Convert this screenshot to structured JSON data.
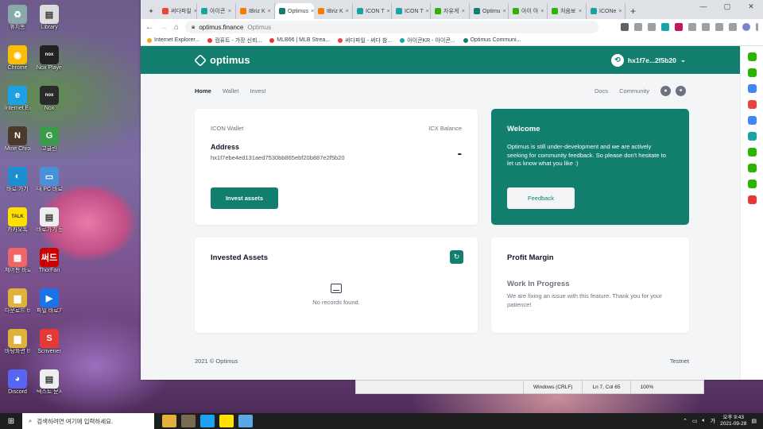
{
  "desktop": {
    "icons": [
      {
        "label": "휴지통",
        "color": "#8aa",
        "glyph": "♻"
      },
      {
        "label": "Library",
        "color": "#ddd",
        "glyph": "▤"
      },
      {
        "label": "Chrome",
        "color": "#fbbc05",
        "glyph": "◉"
      },
      {
        "label": "Nox Player",
        "color": "#222",
        "glyph": "nox"
      },
      {
        "label": "Internet Explorer",
        "color": "#1ea0e4",
        "glyph": "e"
      },
      {
        "label": "Nox",
        "color": "#2a2a2a",
        "glyph": "nox"
      },
      {
        "label": "Mine Chronicles",
        "color": "#4a3a2a",
        "glyph": "N"
      },
      {
        "label": "고클린",
        "color": "#3b9c4b",
        "glyph": "G"
      },
      {
        "label": "바로 가기",
        "color": "#1b8fd0",
        "glyph": "◐"
      },
      {
        "label": "내 PC 바로가기",
        "color": "#4a90d9",
        "glyph": "▭"
      },
      {
        "label": "카카오톡",
        "color": "#ffe000",
        "glyph": "TALK"
      },
      {
        "label": "바로가기 문서",
        "color": "#eee",
        "glyph": "▤"
      },
      {
        "label": "제어판 바로가기",
        "color": "#e66",
        "glyph": "▦"
      },
      {
        "label": "ThorFan",
        "color": "#c00",
        "glyph": "써드"
      },
      {
        "label": "다운로드 바로가기",
        "color": "#e0b23c",
        "glyph": "▆"
      },
      {
        "label": "파일 바로가기",
        "color": "#1a73e8",
        "glyph": "▶"
      },
      {
        "label": "바탕화면 바로가기",
        "color": "#e0b23c",
        "glyph": "▆"
      },
      {
        "label": "Scrivener",
        "color": "#e53935",
        "glyph": "S"
      },
      {
        "label": "Discord",
        "color": "#5865f2",
        "glyph": "◕"
      },
      {
        "label": "텍스트 문서",
        "color": "#eee",
        "glyph": "▤"
      }
    ]
  },
  "browser": {
    "tabs": [
      {
        "label": "써다파일",
        "color": "#e8453c",
        "active": false
      },
      {
        "label": "아이콘",
        "color": "#1aa3a3",
        "active": false
      },
      {
        "label": "IBriz K",
        "color": "#f57c00",
        "active": false
      },
      {
        "label": "Optimus",
        "color": "#127e6d",
        "active": true
      },
      {
        "label": "IBriz K",
        "color": "#f57c00",
        "active": false
      },
      {
        "label": "ICON T",
        "color": "#1aa3a3",
        "active": false
      },
      {
        "label": "ICON T",
        "color": "#1aa3a3",
        "active": false
      },
      {
        "label": "자유게",
        "color": "#2db400",
        "active": false
      },
      {
        "label": "Optimu",
        "color": "#127e6d",
        "active": false
      },
      {
        "label": "아이 아",
        "color": "#2db400",
        "active": false
      },
      {
        "label": "처음보",
        "color": "#2db400",
        "active": false
      },
      {
        "label": "ICONe",
        "color": "#1aa3a3",
        "active": false
      }
    ],
    "new_tab": "+",
    "url": "optimus.finance",
    "site_name": "Optimus",
    "bookmarks": [
      {
        "label": "Internet Explorer...",
        "color": "#f5a623"
      },
      {
        "label": "컴퓨트 - 가장 신뢰...",
        "color": "#e53935"
      },
      {
        "label": "MLB66 | MLB Strea...",
        "color": "#e53935"
      },
      {
        "label": "써다파일 - 써다 참...",
        "color": "#e8453c"
      },
      {
        "label": "아이콘KR - 아이콘...",
        "color": "#1aa3a3"
      },
      {
        "label": "Optimus Communi...",
        "color": "#127e6d"
      }
    ]
  },
  "app": {
    "logo_text": "optimus",
    "wallet_short": "hx1f7e...2f5b20",
    "nav": {
      "home": "Home",
      "wallet": "Wallet",
      "invest": "Invest",
      "docs": "Docs",
      "community": "Community"
    },
    "wallet_card": {
      "left_label": "ICON Wallet",
      "right_label": "ICX Balance",
      "address_label": "Address",
      "address": "hx1f7ebe4ed131aed7530bb865ebf20b887e2f5b20",
      "balance": "-",
      "button": "Invest assets"
    },
    "welcome_card": {
      "title": "Welcome",
      "body": "Optimus is still under-development and we are actively seeking for community feedback. So please don't hesitate to let us know what you like :)",
      "button": "Feedback"
    },
    "invested_card": {
      "title": "Invested Assets",
      "empty": "No records found."
    },
    "profit_card": {
      "title": "Profit Margin",
      "wip_title": "Work In Progress",
      "wip_desc": "We are fixing an issue with this feature. Thank you for your patience!"
    },
    "footer": {
      "left": "2021 © Optimus",
      "right": "Testnet"
    }
  },
  "notepad_status": {
    "encoding": "Windows (CRLF)",
    "position": "Ln 7, Col 65",
    "zoom": "100%"
  },
  "taskbar": {
    "search_placeholder": "검색하려면 여기에 입력하세요.",
    "time": "오후 9:43",
    "date": "2021-09-28"
  },
  "colors": {
    "brand": "#127e6d",
    "bg": "#f4f5f7"
  }
}
